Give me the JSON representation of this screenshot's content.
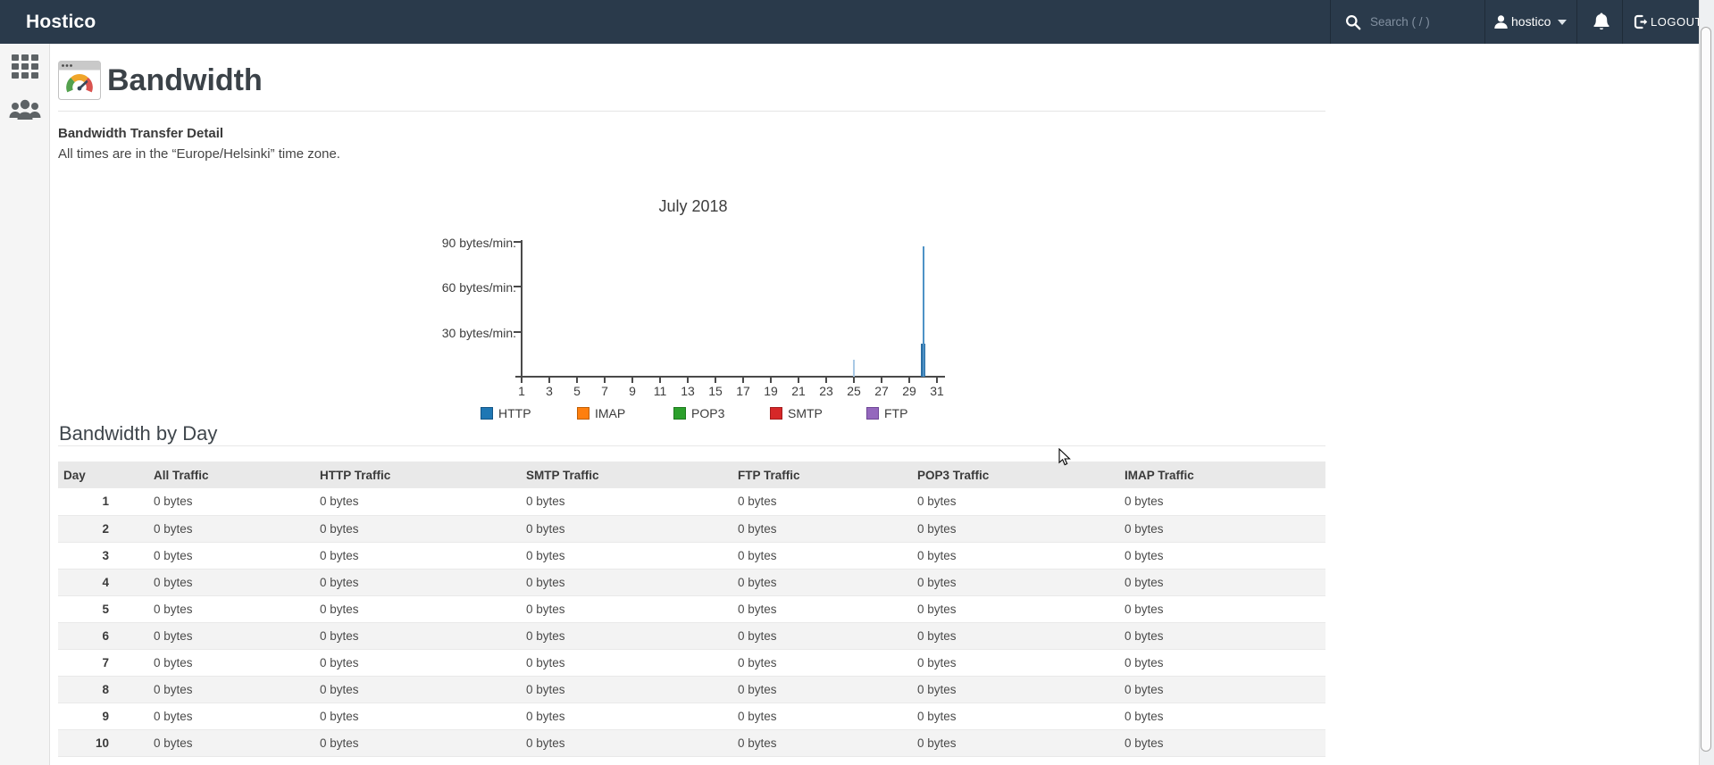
{
  "topbar": {
    "brand": "Hostico",
    "search_placeholder": "Search ( / )",
    "username": "hostico",
    "logout_label": "LOGOUT",
    "bar_color": "#2a3a4b"
  },
  "sidebar": {
    "items": [
      {
        "name": "applications",
        "icon": "grid-icon"
      },
      {
        "name": "customers",
        "icon": "users-icon"
      }
    ]
  },
  "page": {
    "title": "Bandwidth",
    "title_icon": "gauge-window-icon",
    "section_heading": "Bandwidth Transfer Detail",
    "timezone_note": "All times are in the “Europe/Helsinki” time zone.",
    "table_heading": "Bandwidth by Day"
  },
  "chart_data": {
    "type": "bar",
    "title": "July 2018",
    "xlabel": "",
    "ylabel": "bytes/min.",
    "ylim": [
      0,
      95
    ],
    "grid": false,
    "legend_position": "bottom",
    "x_ticks": [
      "1",
      "3",
      "5",
      "7",
      "9",
      "11",
      "13",
      "15",
      "17",
      "19",
      "21",
      "23",
      "25",
      "27",
      "29",
      "31"
    ],
    "y_ticks": [
      {
        "label": "90 bytes/min.",
        "value": 90
      },
      {
        "label": "60 bytes/min.",
        "value": 60
      },
      {
        "label": "30 bytes/min.",
        "value": 30
      }
    ],
    "legend": [
      {
        "label": "HTTP",
        "color": "#1f77b4",
        "border": "#135586"
      },
      {
        "label": "IMAP",
        "color": "#ff7f0e",
        "border": "#c05f06"
      },
      {
        "label": "POP3",
        "color": "#2ca02c",
        "border": "#1e7a1e"
      },
      {
        "label": "SMTP",
        "color": "#d62728",
        "border": "#a31b1c"
      },
      {
        "label": "FTP",
        "color": "#9467bd",
        "border": "#6e4796"
      }
    ],
    "series": [
      {
        "name": "HTTP",
        "note": "all days 0 bytes/min. except the points below",
        "points": [
          {
            "day": 25,
            "peak": 11,
            "peak_color": "#a9c9e5"
          },
          {
            "day": 30,
            "peak": 87,
            "peak_color": "#4e92c6",
            "avg": 22,
            "avg_color": "#2c70a5"
          }
        ]
      }
    ]
  },
  "table": {
    "headers": [
      "Day",
      "All Traffic",
      "HTTP Traffic",
      "SMTP Traffic",
      "FTP Traffic",
      "POP3 Traffic",
      "IMAP Traffic"
    ],
    "col_keys": [
      "all",
      "http",
      "smtp",
      "ftp",
      "pop3",
      "imap"
    ],
    "rows": [
      {
        "day": "1",
        "all": "0 bytes",
        "http": "0 bytes",
        "smtp": "0 bytes",
        "ftp": "0 bytes",
        "pop3": "0 bytes",
        "imap": "0 bytes"
      },
      {
        "day": "2",
        "all": "0 bytes",
        "http": "0 bytes",
        "smtp": "0 bytes",
        "ftp": "0 bytes",
        "pop3": "0 bytes",
        "imap": "0 bytes"
      },
      {
        "day": "3",
        "all": "0 bytes",
        "http": "0 bytes",
        "smtp": "0 bytes",
        "ftp": "0 bytes",
        "pop3": "0 bytes",
        "imap": "0 bytes"
      },
      {
        "day": "4",
        "all": "0 bytes",
        "http": "0 bytes",
        "smtp": "0 bytes",
        "ftp": "0 bytes",
        "pop3": "0 bytes",
        "imap": "0 bytes"
      },
      {
        "day": "5",
        "all": "0 bytes",
        "http": "0 bytes",
        "smtp": "0 bytes",
        "ftp": "0 bytes",
        "pop3": "0 bytes",
        "imap": "0 bytes"
      },
      {
        "day": "6",
        "all": "0 bytes",
        "http": "0 bytes",
        "smtp": "0 bytes",
        "ftp": "0 bytes",
        "pop3": "0 bytes",
        "imap": "0 bytes"
      },
      {
        "day": "7",
        "all": "0 bytes",
        "http": "0 bytes",
        "smtp": "0 bytes",
        "ftp": "0 bytes",
        "pop3": "0 bytes",
        "imap": "0 bytes"
      },
      {
        "day": "8",
        "all": "0 bytes",
        "http": "0 bytes",
        "smtp": "0 bytes",
        "ftp": "0 bytes",
        "pop3": "0 bytes",
        "imap": "0 bytes"
      },
      {
        "day": "9",
        "all": "0 bytes",
        "http": "0 bytes",
        "smtp": "0 bytes",
        "ftp": "0 bytes",
        "pop3": "0 bytes",
        "imap": "0 bytes"
      },
      {
        "day": "10",
        "all": "0 bytes",
        "http": "0 bytes",
        "smtp": "0 bytes",
        "ftp": "0 bytes",
        "pop3": "0 bytes",
        "imap": "0 bytes"
      }
    ]
  }
}
